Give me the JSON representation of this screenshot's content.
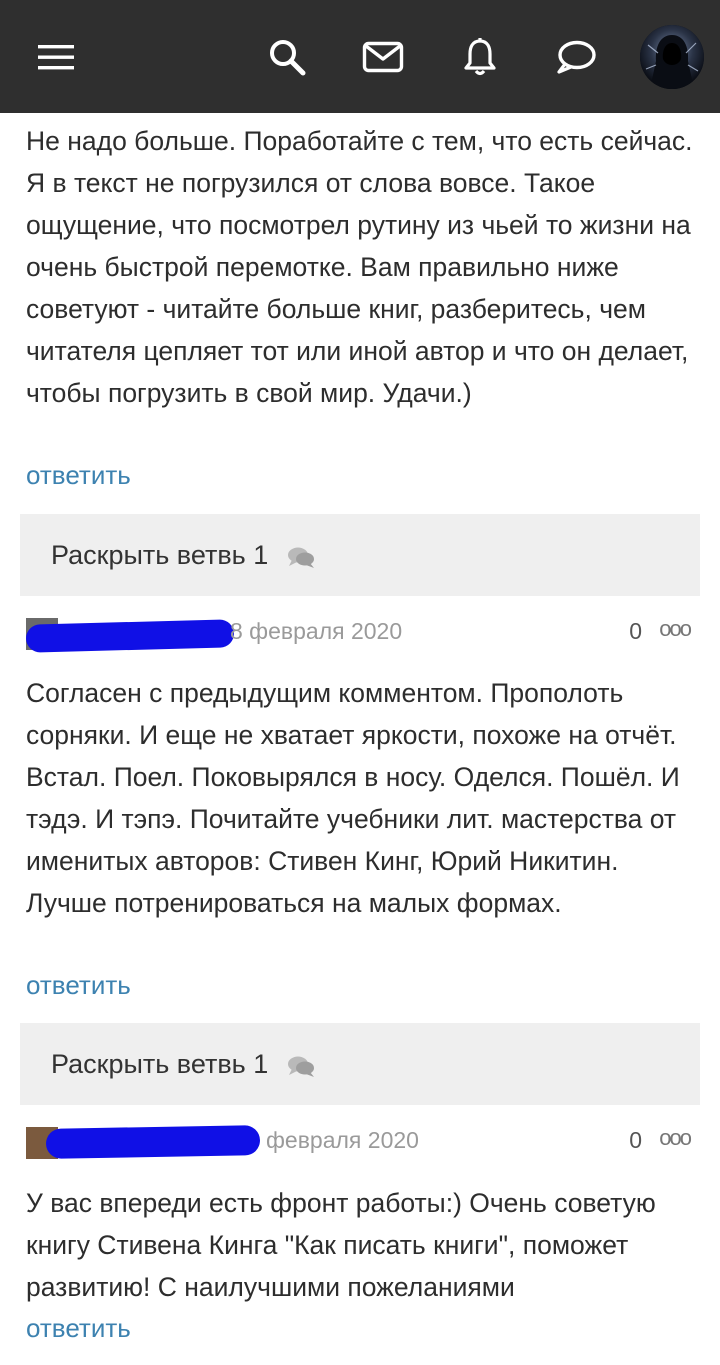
{
  "header": {
    "icons": [
      "menu-icon",
      "search-icon",
      "mail-icon",
      "bell-icon",
      "chat-icon"
    ]
  },
  "comments": [
    {
      "text": "Не надо больше. Поработайте с тем, что есть сейчас. Я в текст не погрузился от слова вовсе. Такое ощущение, что посмотрел рутину из чьей то жизни на очень быстрой перемотке. Вам правильно ниже советуют - читайте больше книг, разберитесь, чем читателя цепляет тот или иной автор и что он делает, чтобы погрузить в свой мир. Удачи.)",
      "reply": "ответить",
      "thread": "Раскрыть ветвь 1"
    },
    {
      "date": "8 февраля 2020",
      "votes": "0",
      "more": "ооо",
      "text": "Согласен с предыдущим комментом. Прополоть сорняки. И еще не хватает яркости, похоже на отчёт. Встал. Поел. Поковырялся в носу. Оделся. Пошёл. И тэдэ. И тэпэ. Почитайте учебники лит. мастерства от именитых авторов: Стивен Кинг, Юрий Никитин. Лучше потренироваться на малых формах.",
      "reply": "ответить",
      "thread": "Раскрыть ветвь 1"
    },
    {
      "date": "февраля 2020",
      "votes": "0",
      "more": "ооо",
      "text": "У вас впереди есть фронт работы:) Очень советую книгу Стивена Кинга \"Как писать книги\", поможет развитию! С наилучшими пожеланиями",
      "reply": "ответить"
    }
  ],
  "colors": {
    "topbar": "#2f2f2f",
    "link": "#3d82b0",
    "thread_bg": "#efefef",
    "redaction": "#1010e6"
  }
}
